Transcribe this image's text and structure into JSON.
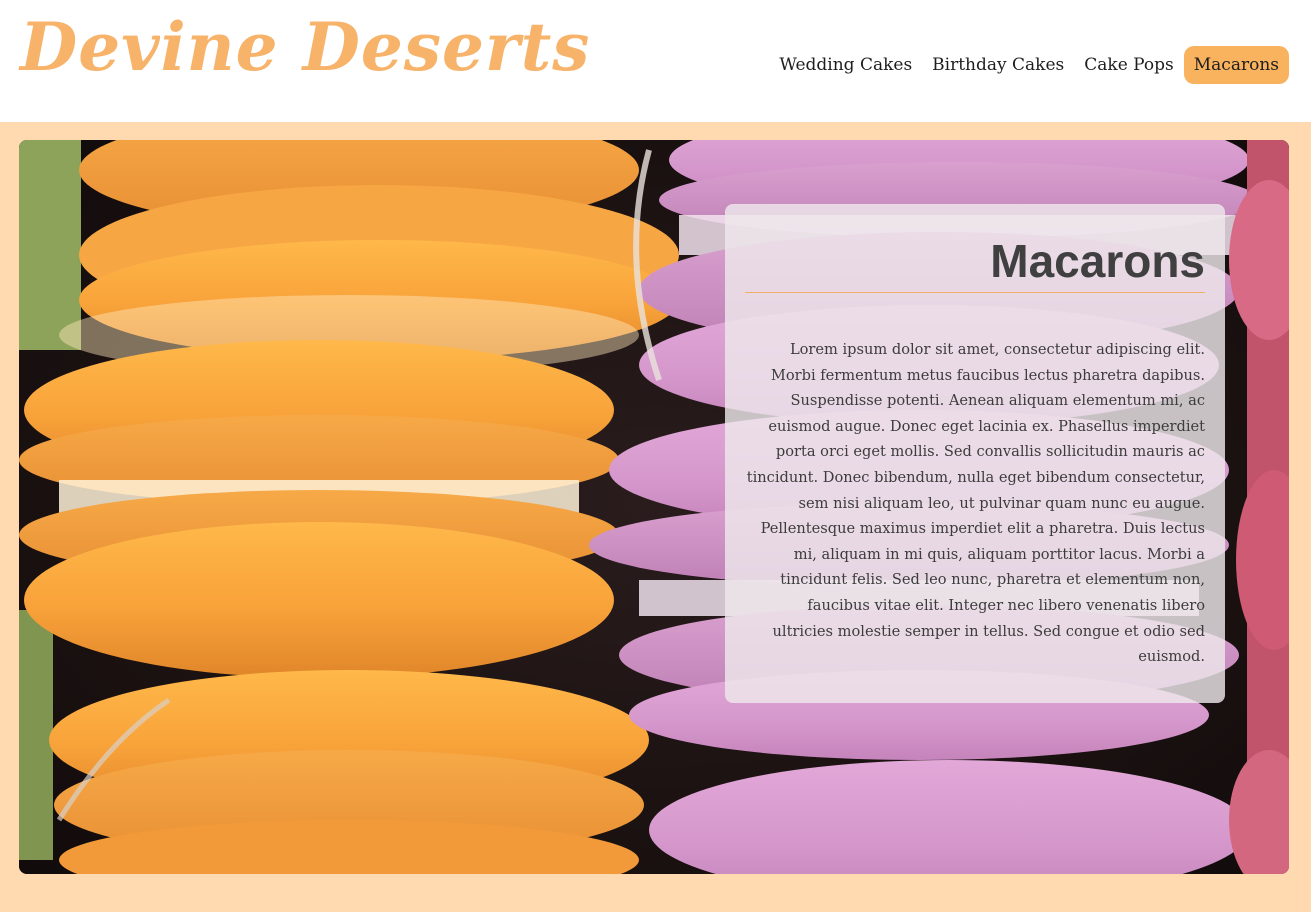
{
  "brand": {
    "name": "Devine Deserts",
    "color": "#f7b36a"
  },
  "nav": {
    "items": [
      {
        "label": "Wedding Cakes"
      },
      {
        "label": "Birthday Cakes"
      },
      {
        "label": "Cake Pops"
      },
      {
        "label": "Macarons"
      }
    ],
    "active_label": "Macarons",
    "active_color": "#f9b25e"
  },
  "hero": {
    "image": "macarons-photo",
    "card": {
      "title": "Macarons",
      "body": "Lorem ipsum dolor sit amet, consectetur adipiscing elit. Morbi fermentum metus faucibus lectus pharetra dapibus. Suspendisse potenti. Aenean aliquam elementum mi, ac euismod augue. Donec eget lacinia ex. Phasellus imperdiet porta orci eget mollis. Sed convallis sollicitudin mauris ac tincidunt. Donec bibendum, nulla eget bibendum consectetur, sem nisi aliquam leo, ut pulvinar quam nunc eu augue. Pellentesque maximus imperdiet elit a pharetra. Duis lectus mi, aliquam in mi quis, aliquam porttitor lacus. Morbi a tincidunt felis. Sed leo nunc, pharetra et elementum non, faucibus vitae elit. Integer nec libero venenatis libero ultricies molestie semper in tellus. Sed congue et odio sed euismod."
    }
  },
  "colors": {
    "page_background": "#ffdab0",
    "header_background": "#ffffff"
  }
}
